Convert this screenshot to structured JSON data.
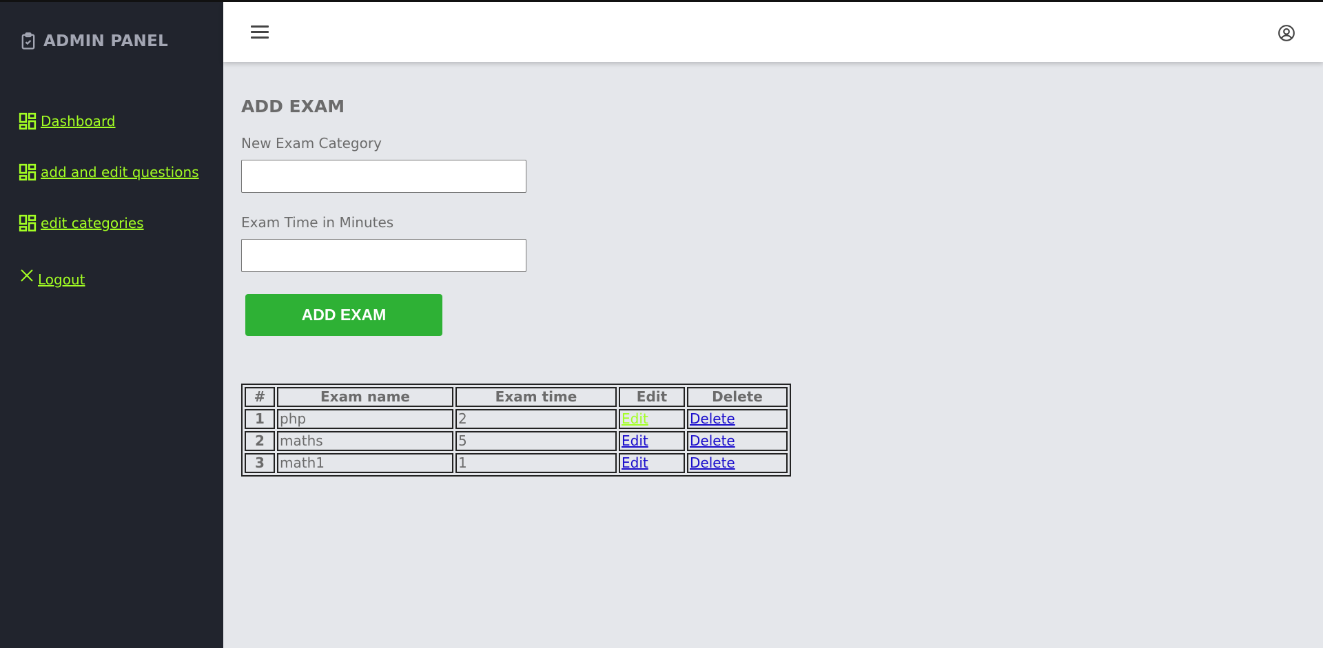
{
  "brand": {
    "title": "ADMIN PANEL"
  },
  "sidebar": {
    "items": [
      {
        "label": " Dashboard"
      },
      {
        "label": " add and edit questions"
      },
      {
        "label": " edit categories"
      },
      {
        "label": " Logout"
      }
    ]
  },
  "page": {
    "title": "ADD EXAM",
    "category_label": "New Exam Category",
    "category_value": "",
    "time_label": "Exam Time in Minutes",
    "time_value": "",
    "submit_label": "ADD EXAM"
  },
  "table": {
    "headers": [
      "#",
      "Exam name",
      "Exam time",
      "Edit",
      "Delete"
    ],
    "rows": [
      {
        "num": "1",
        "name": "php",
        "time": "2",
        "edit": "Edit",
        "delete": "Delete"
      },
      {
        "num": "2",
        "name": "maths",
        "time": "5",
        "edit": "Edit",
        "delete": "Delete"
      },
      {
        "num": "3",
        "name": "math1",
        "time": "1",
        "edit": "Edit",
        "delete": "Delete"
      }
    ]
  },
  "colors": {
    "sidebar_bg": "#21242d",
    "nav_link": "#a3ff23",
    "button_green": "#2eb135",
    "link_blue": "#1a0dcc"
  },
  "icons": {
    "brand": "clipboard-check-icon",
    "nav": "dashboard-grid-icon",
    "logout": "close-icon",
    "menu": "hamburger-menu-icon",
    "user": "user-circle-icon"
  }
}
